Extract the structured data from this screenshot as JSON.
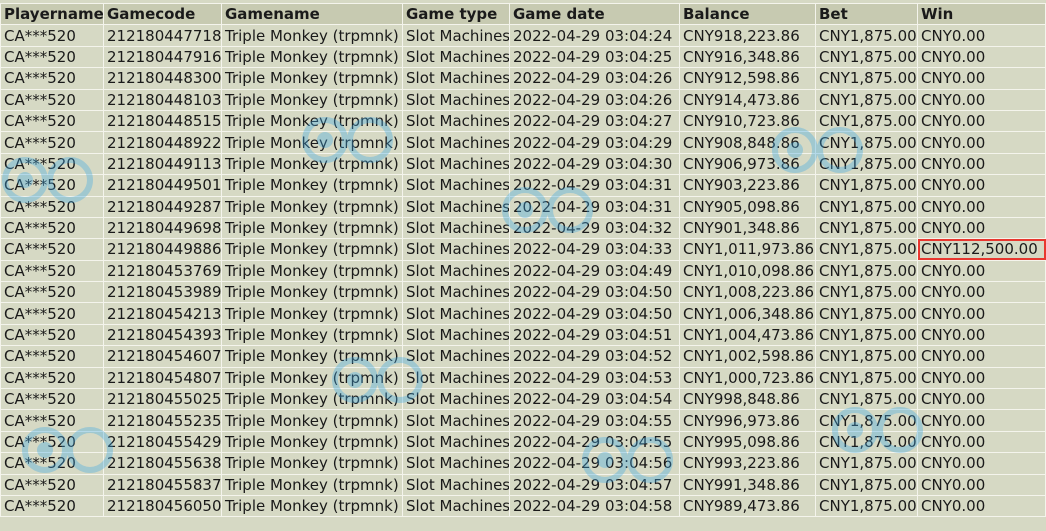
{
  "table": {
    "headers": [
      "Playername",
      "Gamecode",
      "Gamename",
      "Game type",
      "Game date",
      "Balance",
      "Bet",
      "Win"
    ],
    "rows": [
      [
        "CA***520",
        "212180447718",
        "Triple Monkey (trpmnk)",
        "Slot Machines",
        "2022-04-29 03:04:24",
        "CNY918,223.86",
        "CNY1,875.00",
        "CNY0.00"
      ],
      [
        "CA***520",
        "212180447916",
        "Triple Monkey (trpmnk)",
        "Slot Machines",
        "2022-04-29 03:04:25",
        "CNY916,348.86",
        "CNY1,875.00",
        "CNY0.00"
      ],
      [
        "CA***520",
        "212180448300",
        "Triple Monkey (trpmnk)",
        "Slot Machines",
        "2022-04-29 03:04:26",
        "CNY912,598.86",
        "CNY1,875.00",
        "CNY0.00"
      ],
      [
        "CA***520",
        "212180448103",
        "Triple Monkey (trpmnk)",
        "Slot Machines",
        "2022-04-29 03:04:26",
        "CNY914,473.86",
        "CNY1,875.00",
        "CNY0.00"
      ],
      [
        "CA***520",
        "212180448515",
        "Triple Monkey (trpmnk)",
        "Slot Machines",
        "2022-04-29 03:04:27",
        "CNY910,723.86",
        "CNY1,875.00",
        "CNY0.00"
      ],
      [
        "CA***520",
        "212180448922",
        "Triple Monkey (trpmnk)",
        "Slot Machines",
        "2022-04-29 03:04:29",
        "CNY908,848.86",
        "CNY1,875.00",
        "CNY0.00"
      ],
      [
        "CA***520",
        "212180449113",
        "Triple Monkey (trpmnk)",
        "Slot Machines",
        "2022-04-29 03:04:30",
        "CNY906,973.86",
        "CNY1,875.00",
        "CNY0.00"
      ],
      [
        "CA***520",
        "212180449501",
        "Triple Monkey (trpmnk)",
        "Slot Machines",
        "2022-04-29 03:04:31",
        "CNY903,223.86",
        "CNY1,875.00",
        "CNY0.00"
      ],
      [
        "CA***520",
        "212180449287",
        "Triple Monkey (trpmnk)",
        "Slot Machines",
        "2022-04-29 03:04:31",
        "CNY905,098.86",
        "CNY1,875.00",
        "CNY0.00"
      ],
      [
        "CA***520",
        "212180449698",
        "Triple Monkey (trpmnk)",
        "Slot Machines",
        "2022-04-29 03:04:32",
        "CNY901,348.86",
        "CNY1,875.00",
        "CNY0.00"
      ],
      [
        "CA***520",
        "212180449886",
        "Triple Monkey (trpmnk)",
        "Slot Machines",
        "2022-04-29 03:04:33",
        "CNY1,011,973.86",
        "CNY1,875.00",
        "CNY112,500.00"
      ],
      [
        "CA***520",
        "212180453769",
        "Triple Monkey (trpmnk)",
        "Slot Machines",
        "2022-04-29 03:04:49",
        "CNY1,010,098.86",
        "CNY1,875.00",
        "CNY0.00"
      ],
      [
        "CA***520",
        "212180453989",
        "Triple Monkey (trpmnk)",
        "Slot Machines",
        "2022-04-29 03:04:50",
        "CNY1,008,223.86",
        "CNY1,875.00",
        "CNY0.00"
      ],
      [
        "CA***520",
        "212180454213",
        "Triple Monkey (trpmnk)",
        "Slot Machines",
        "2022-04-29 03:04:50",
        "CNY1,006,348.86",
        "CNY1,875.00",
        "CNY0.00"
      ],
      [
        "CA***520",
        "212180454393",
        "Triple Monkey (trpmnk)",
        "Slot Machines",
        "2022-04-29 03:04:51",
        "CNY1,004,473.86",
        "CNY1,875.00",
        "CNY0.00"
      ],
      [
        "CA***520",
        "212180454607",
        "Triple Monkey (trpmnk)",
        "Slot Machines",
        "2022-04-29 03:04:52",
        "CNY1,002,598.86",
        "CNY1,875.00",
        "CNY0.00"
      ],
      [
        "CA***520",
        "212180454807",
        "Triple Monkey (trpmnk)",
        "Slot Machines",
        "2022-04-29 03:04:53",
        "CNY1,000,723.86",
        "CNY1,875.00",
        "CNY0.00"
      ],
      [
        "CA***520",
        "212180455025",
        "Triple Monkey (trpmnk)",
        "Slot Machines",
        "2022-04-29 03:04:54",
        "CNY998,848.86",
        "CNY1,875.00",
        "CNY0.00"
      ],
      [
        "CA***520",
        "212180455235",
        "Triple Monkey (trpmnk)",
        "Slot Machines",
        "2022-04-29 03:04:55",
        "CNY996,973.86",
        "CNY1,875.00",
        "CNY0.00"
      ],
      [
        "CA***520",
        "212180455429",
        "Triple Monkey (trpmnk)",
        "Slot Machines",
        "2022-04-29 03:04:55",
        "CNY995,098.86",
        "CNY1,875.00",
        "CNY0.00"
      ],
      [
        "CA***520",
        "212180455638",
        "Triple Monkey (trpmnk)",
        "Slot Machines",
        "2022-04-29 03:04:56",
        "CNY993,223.86",
        "CNY1,875.00",
        "CNY0.00"
      ],
      [
        "CA***520",
        "212180455837",
        "Triple Monkey (trpmnk)",
        "Slot Machines",
        "2022-04-29 03:04:57",
        "CNY991,348.86",
        "CNY1,875.00",
        "CNY0.00"
      ],
      [
        "CA***520",
        "212180456050",
        "Triple Monkey (trpmnk)",
        "Slot Machines",
        "2022-04-29 03:04:58",
        "CNY989,473.86",
        "CNY1,875.00",
        "CNY0.00"
      ]
    ],
    "highlighted_row": 10,
    "highlighted_column": 7
  },
  "colors": {
    "cell_bg": "#d6d9c4",
    "header_bg": "#c7cab1",
    "grid_line": "#f4f4ec",
    "highlight_border": "#e8372f",
    "watermark": "#3fa9e6"
  }
}
